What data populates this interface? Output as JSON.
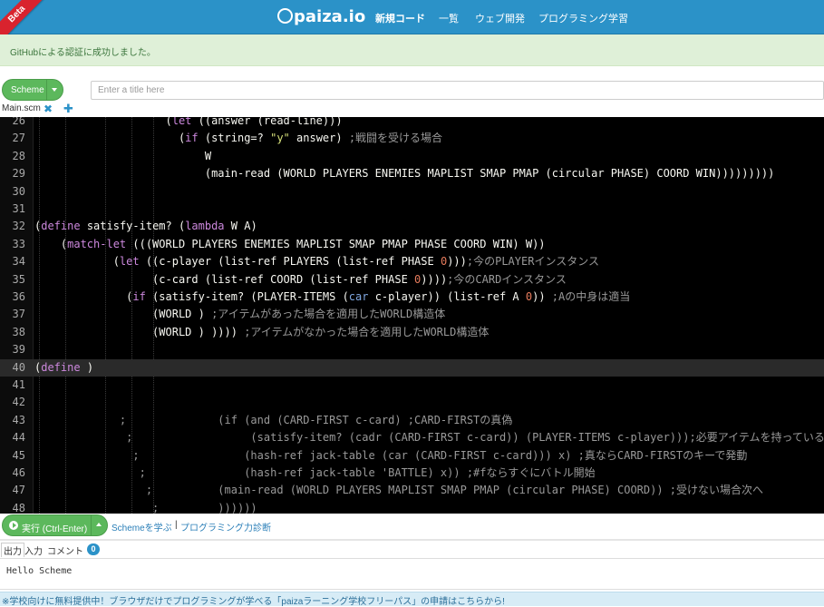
{
  "header": {
    "beta": "Beta",
    "logo": "paiza.io",
    "nav": [
      "新規コード",
      "一覧",
      "ウェブ開発",
      "プログラミング学習"
    ]
  },
  "flash": {
    "message": "GitHubによる認証に成功しました。"
  },
  "toolbar": {
    "language": "Scheme",
    "title_placeholder": "Enter a title here",
    "title_value": ""
  },
  "tabs": {
    "file": "Main.scm"
  },
  "editor": {
    "active_line": 40,
    "lines": [
      {
        "n": "26",
        "text": "                    (let ((answer (read-line)))"
      },
      {
        "n": "27",
        "text": "                      (if (string=? \"y\" answer) ;戦闘を受ける場合"
      },
      {
        "n": "28",
        "text": "                          W"
      },
      {
        "n": "29",
        "text": "                          (main-read (WORLD PLAYERS ENEMIES MAPLIST SMAP PMAP (circular PHASE) COORD WIN)))))))))"
      },
      {
        "n": "30",
        "text": ""
      },
      {
        "n": "31",
        "text": ""
      },
      {
        "n": "32",
        "text": "(define satisfy-item? (lambda W A)"
      },
      {
        "n": "33",
        "text": "    (match-let (((WORLD PLAYERS ENEMIES MAPLIST SMAP PMAP PHASE COORD WIN) W))"
      },
      {
        "n": "34",
        "text": "            (let ((c-player (list-ref PLAYERS (list-ref PHASE 0)));今のPLAYERインスタンス"
      },
      {
        "n": "35",
        "text": "                  (c-card (list-ref COORD (list-ref PHASE 0))));今のCARDインスタンス"
      },
      {
        "n": "36",
        "text": "              (if (satisfy-item? (PLAYER-ITEMS (car c-player)) (list-ref A 0)) ;Aの中身は適当"
      },
      {
        "n": "37",
        "text": "                  (WORLD ) ;アイテムがあった場合を適用したWORLD構造体"
      },
      {
        "n": "38",
        "text": "                  (WORLD ) )))) ;アイテムがなかった場合を適用したWORLD構造体"
      },
      {
        "n": "39",
        "text": ""
      },
      {
        "n": "40",
        "text": "(define )"
      },
      {
        "n": "41",
        "text": ""
      },
      {
        "n": "42",
        "text": ""
      },
      {
        "n": "43",
        "text": "             ;              (if (and (CARD-FIRST c-card) ;CARD-FIRSTの真偽"
      },
      {
        "n": "44",
        "text": "              ;                  (satisfy-item? (cadr (CARD-FIRST c-card)) (PLAYER-ITEMS c-player)));必要アイテムを持っている?"
      },
      {
        "n": "45",
        "text": "               ;                (hash-ref jack-table (car (CARD-FIRST c-card))) x) ;真ならCARD-FIRSTのキーで発動"
      },
      {
        "n": "46",
        "text": "                ;               (hash-ref jack-table 'BATTLE) x)) ;#fならすぐにバトル開始"
      },
      {
        "n": "47",
        "text": "                 ;          (main-read (WORLD PLAYERS MAPLIST SMAP PMAP (circular PHASE) COORD)) ;受けない場合次へ"
      },
      {
        "n": "48",
        "text": "                  ;         ))))))"
      }
    ]
  },
  "run": {
    "label": "実行 (Ctrl-Enter)",
    "link_learn": "Schemeを学ぶ",
    "separator": "|",
    "link_diagnose": "プログラミング力診断"
  },
  "io": {
    "tabs": [
      "出力",
      "入力",
      "コメント"
    ],
    "comment_count": "0",
    "output": "Hello Scheme"
  },
  "footer": {
    "notice": "※学校向けに無料提供中！ブラウザだけでプログラミングが学べる「paizaラーニング学校フリーパス」の申請はこちらから!"
  },
  "colors": {
    "header": "#2b92c8",
    "run_button": "#5cb85c",
    "editor_bg": "#000000",
    "keyword": "#cc88dd",
    "string": "#d6e07a",
    "number": "#e67b5c",
    "comment": "#999999"
  }
}
